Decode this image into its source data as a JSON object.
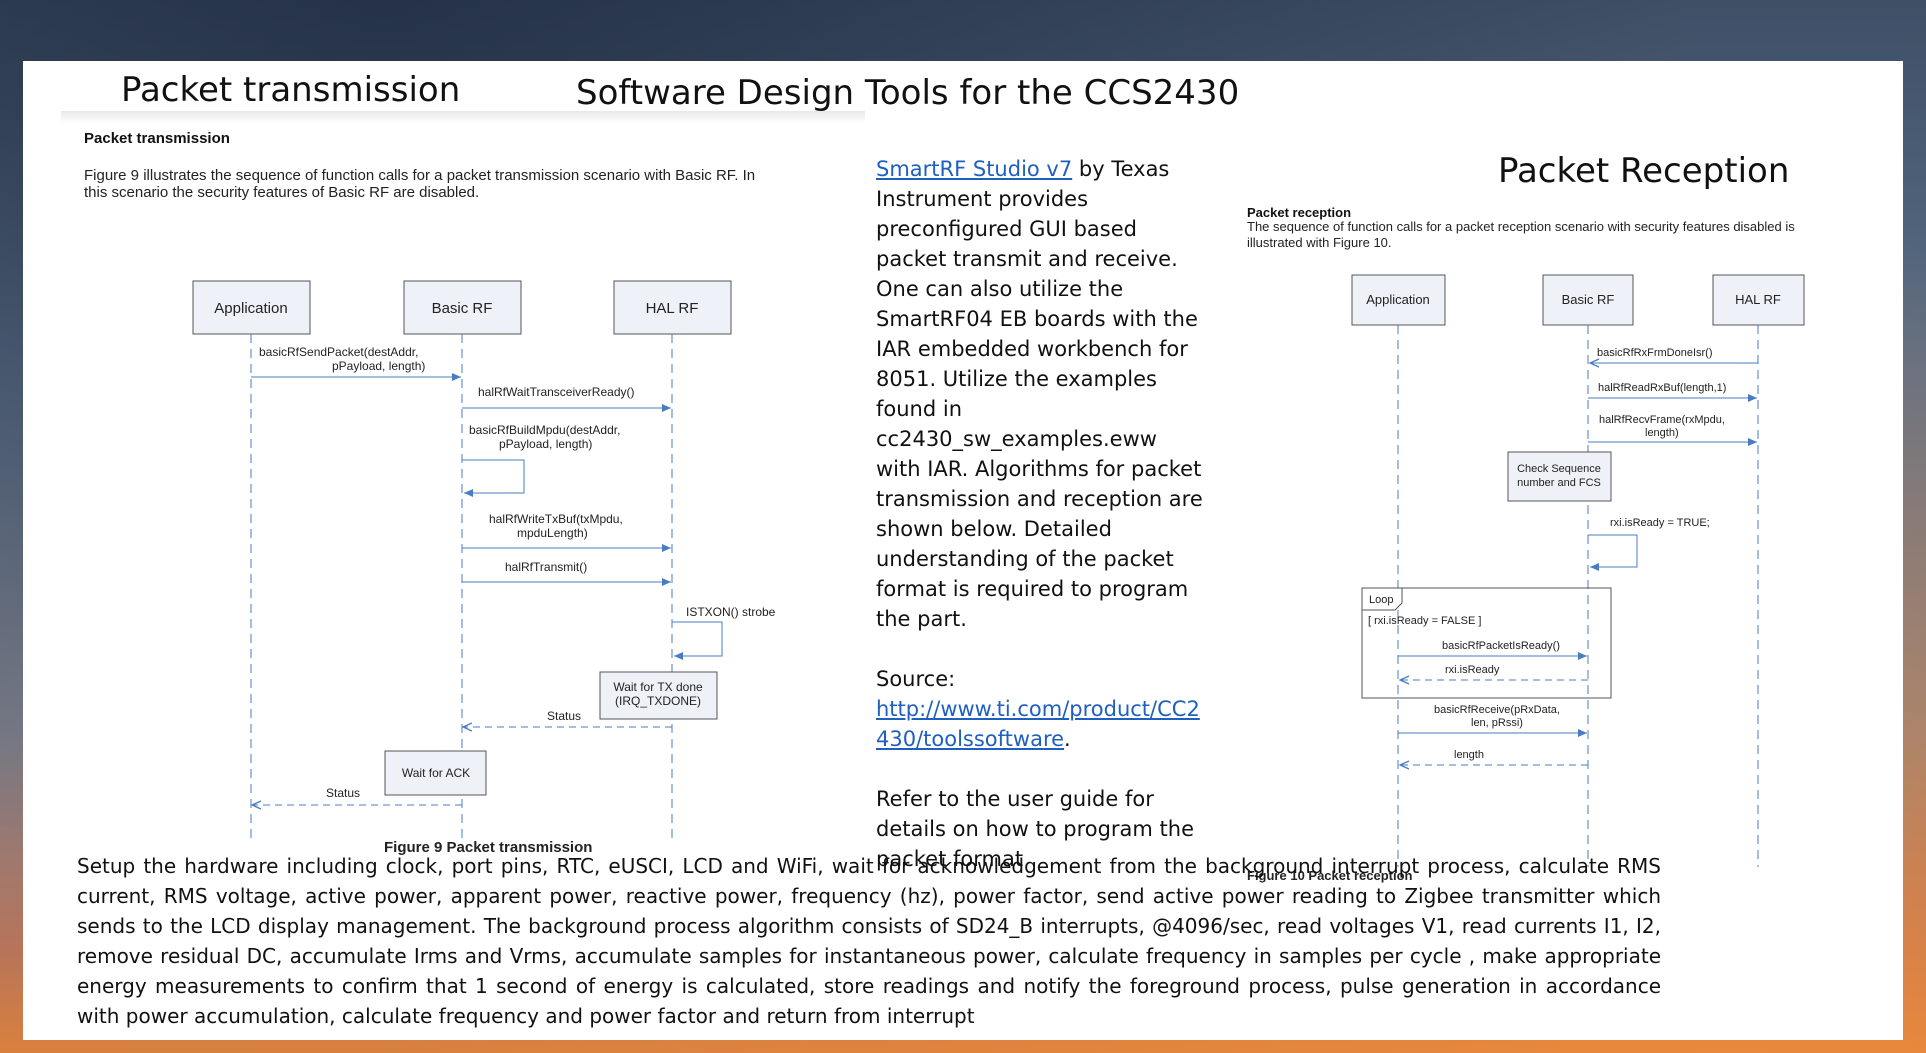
{
  "slide": {
    "title": "Software Design Tools for the CCS2430",
    "left_heading": "Packet transmission",
    "right_heading": "Packet Reception"
  },
  "fig_tx": {
    "section_title": "Packet transmission",
    "intro_line1": "Figure 9 illustrates the sequence of function calls for a packet transmission scenario with Basic RF. In",
    "intro_line2": "this scenario the security features of Basic RF are disabled.",
    "lifelines": [
      "Application",
      "Basic RF",
      "HAL RF"
    ],
    "msg1_l1": "basicRfSendPacket(destAddr,",
    "msg1_l2": "pPayload, length)",
    "msg2": "halRfWaitTransceiverReady()",
    "msg3_l1": "basicRfBuildMpdu(destAddr,",
    "msg3_l2": "pPayload, length)",
    "msg4_l1": "halRfWriteTxBuf(txMpdu,",
    "msg4_l2": "mpduLength)",
    "msg5": "halRfTransmit()",
    "msg6": "ISTXON() strobe",
    "box_wait_tx_l1": "Wait for TX done",
    "box_wait_tx_l2": "(IRQ_TXDONE)",
    "msg7": "Status",
    "box_wait_ack": "Wait for ACK",
    "msg8": "Status",
    "caption": "Figure 9 Packet transmission"
  },
  "middle": {
    "tool_link": "SmartRF Studio v7",
    "p1_rest": " by Texas Instrument provides preconfigured GUI based packet transmit and receive.",
    "p2": "One can also utilize the SmartRF04 EB boards with the IAR embedded workbench for 8051. Utilize the examples found in cc2430_sw_examples.eww with IAR. Algorithms for packet transmission and reception are shown below. Detailed understanding of the packet format is required to program the part.",
    "source_label": "Source:",
    "source_url": "http://www.ti.com/product/CC2430/toolssoftware",
    "source_period": ".",
    "p4": "Refer to the user guide for details on how to program the packet format"
  },
  "fig_rx": {
    "section_title": "Packet reception",
    "intro_line1": "The sequence of function calls for a packet reception scenario with security features disabled is",
    "intro_line2": "illustrated with Figure 10.",
    "lifelines": [
      "Application",
      "Basic RF",
      "HAL RF"
    ],
    "msg1": "basicRfRxFrmDoneIsr()",
    "msg2": "halRfReadRxBuf(length,1)",
    "msg3_l1": "halRfRecvFrame(rxMpdu,",
    "msg3_l2": "length)",
    "box_check_l1": "Check Sequence",
    "box_check_l2": "number and FCS",
    "msg4": "rxi.isReady = TRUE;",
    "loop_label": "Loop",
    "loop_guard": "[ rxi.isReady = FALSE ]",
    "msg5": "basicRfPacketIsReady()",
    "msg6": "rxi.isReady",
    "msg7_l1": "basicRfReceive(pRxData,",
    "msg7_l2": "len, pRssi)",
    "msg8": "length",
    "caption": "Figure 10 Packet reception"
  },
  "bottom_paragraph": "Setup the hardware including clock, port pins, RTC, eUSCI, LCD and WiFi, wait for acknowledgement from the background interrupt process, calculate RMS current, RMS voltage, active power, apparent power, reactive power, frequency (hz), power factor, send active power reading to Zigbee transmitter which sends to the LCD display management.   The background process algorithm consists of SD24_B interrupts, @4096/sec, read voltages V1, read currents I1, I2, remove residual DC, accumulate Irms and Vrms, accumulate samples for instantaneous power, calculate frequency in samples per cycle , make appropriate energy measurements to confirm that 1 second of energy is calculated, store readings and notify the foreground process, pulse generation in accordance with power accumulation, calculate frequency and power factor and return from interrupt"
}
